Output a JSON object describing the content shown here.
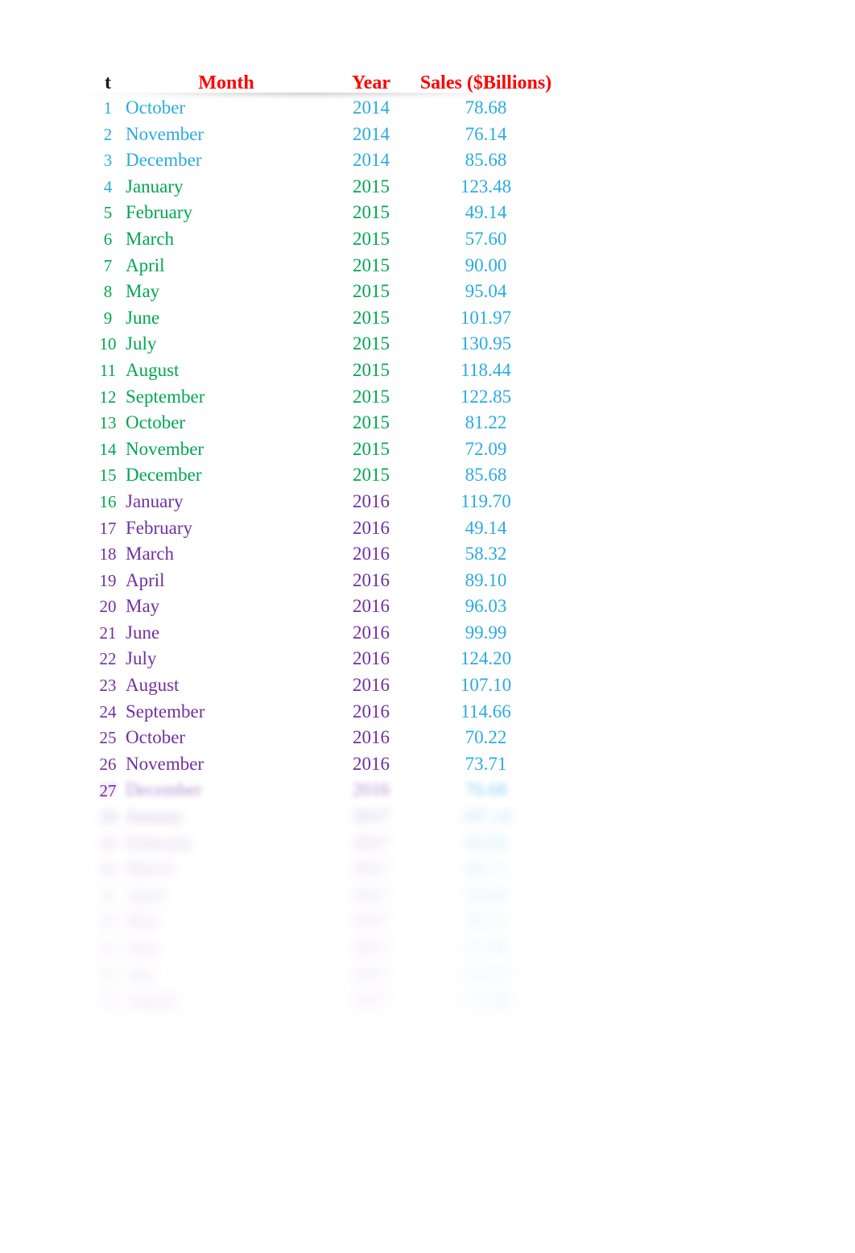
{
  "header": {
    "t_label": "t",
    "month_label": "Month",
    "year_label": "Year",
    "sales_label": "Sales ($Billions)"
  },
  "colors": {
    "header_accent": "#FF0000",
    "header_t": "#1A1A1A",
    "year_2014": "#29ABE2",
    "year_2015": "#00A651",
    "year_2016": "#7030A0",
    "sales": "#29ABE2"
  },
  "table_data": {
    "type": "table",
    "columns": [
      "t",
      "Month",
      "Year",
      "Sales ($Billions)"
    ],
    "rows": [
      {
        "t": "1",
        "month": "October",
        "year": "2014",
        "sales": "78.68",
        "t_color": "#29ABE2",
        "row_color": "#29ABE2",
        "blur": 0,
        "opacity": 1
      },
      {
        "t": "2",
        "month": "November",
        "year": "2014",
        "sales": "76.14",
        "t_color": "#29ABE2",
        "row_color": "#29ABE2",
        "blur": 0,
        "opacity": 1
      },
      {
        "t": "3",
        "month": "December",
        "year": "2014",
        "sales": "85.68",
        "t_color": "#29ABE2",
        "row_color": "#29ABE2",
        "blur": 0,
        "opacity": 1
      },
      {
        "t": "4",
        "month": "January",
        "year": "2015",
        "sales": "123.48",
        "t_color": "#29ABE2",
        "row_color": "#00A651",
        "blur": 0,
        "opacity": 1
      },
      {
        "t": "5",
        "month": "February",
        "year": "2015",
        "sales": "49.14",
        "t_color": "#00A651",
        "row_color": "#00A651",
        "blur": 0,
        "opacity": 1
      },
      {
        "t": "6",
        "month": "March",
        "year": "2015",
        "sales": "57.60",
        "t_color": "#00A651",
        "row_color": "#00A651",
        "blur": 0,
        "opacity": 1
      },
      {
        "t": "7",
        "month": "April",
        "year": "2015",
        "sales": "90.00",
        "t_color": "#00A651",
        "row_color": "#00A651",
        "blur": 0,
        "opacity": 1
      },
      {
        "t": "8",
        "month": "May",
        "year": "2015",
        "sales": "95.04",
        "t_color": "#00A651",
        "row_color": "#00A651",
        "blur": 0,
        "opacity": 1
      },
      {
        "t": "9",
        "month": "June",
        "year": "2015",
        "sales": "101.97",
        "t_color": "#00A651",
        "row_color": "#00A651",
        "blur": 0,
        "opacity": 1
      },
      {
        "t": "10",
        "month": "July",
        "year": "2015",
        "sales": "130.95",
        "t_color": "#00A651",
        "row_color": "#00A651",
        "blur": 0,
        "opacity": 1
      },
      {
        "t": "11",
        "month": "August",
        "year": "2015",
        "sales": "118.44",
        "t_color": "#00A651",
        "row_color": "#00A651",
        "blur": 0,
        "opacity": 1
      },
      {
        "t": "12",
        "month": "September",
        "year": "2015",
        "sales": "122.85",
        "t_color": "#00A651",
        "row_color": "#00A651",
        "blur": 0,
        "opacity": 1
      },
      {
        "t": "13",
        "month": "October",
        "year": "2015",
        "sales": "81.22",
        "t_color": "#00A651",
        "row_color": "#00A651",
        "blur": 0,
        "opacity": 1
      },
      {
        "t": "14",
        "month": "November",
        "year": "2015",
        "sales": "72.09",
        "t_color": "#00A651",
        "row_color": "#00A651",
        "blur": 0,
        "opacity": 1
      },
      {
        "t": "15",
        "month": "December",
        "year": "2015",
        "sales": "85.68",
        "t_color": "#00A651",
        "row_color": "#00A651",
        "blur": 0,
        "opacity": 1
      },
      {
        "t": "16",
        "month": "January",
        "year": "2016",
        "sales": "119.70",
        "t_color": "#00A651",
        "row_color": "#7030A0",
        "blur": 0,
        "opacity": 1
      },
      {
        "t": "17",
        "month": "February",
        "year": "2016",
        "sales": "49.14",
        "t_color": "#7030A0",
        "row_color": "#7030A0",
        "blur": 0,
        "opacity": 1
      },
      {
        "t": "18",
        "month": "March",
        "year": "2016",
        "sales": "58.32",
        "t_color": "#7030A0",
        "row_color": "#7030A0",
        "blur": 0,
        "opacity": 1
      },
      {
        "t": "19",
        "month": "April",
        "year": "2016",
        "sales": "89.10",
        "t_color": "#7030A0",
        "row_color": "#7030A0",
        "blur": 0,
        "opacity": 1
      },
      {
        "t": "20",
        "month": "May",
        "year": "2016",
        "sales": "96.03",
        "t_color": "#7030A0",
        "row_color": "#7030A0",
        "blur": 0,
        "opacity": 1
      },
      {
        "t": "21",
        "month": "June",
        "year": "2016",
        "sales": "99.99",
        "t_color": "#7030A0",
        "row_color": "#7030A0",
        "blur": 0,
        "opacity": 1
      },
      {
        "t": "22",
        "month": "July",
        "year": "2016",
        "sales": "124.20",
        "t_color": "#7030A0",
        "row_color": "#7030A0",
        "blur": 0,
        "opacity": 1
      },
      {
        "t": "23",
        "month": "August",
        "year": "2016",
        "sales": "107.10",
        "t_color": "#7030A0",
        "row_color": "#7030A0",
        "blur": 0,
        "opacity": 1
      },
      {
        "t": "24",
        "month": "September",
        "year": "2016",
        "sales": "114.66",
        "t_color": "#7030A0",
        "row_color": "#7030A0",
        "blur": 0,
        "opacity": 1
      },
      {
        "t": "25",
        "month": "October",
        "year": "2016",
        "sales": "70.22",
        "t_color": "#7030A0",
        "row_color": "#7030A0",
        "blur": 0,
        "opacity": 1
      },
      {
        "t": "26",
        "month": "November",
        "year": "2016",
        "sales": "73.71",
        "t_color": "#7030A0",
        "row_color": "#7030A0",
        "blur": 0,
        "opacity": 1
      },
      {
        "t": "27",
        "month": "December",
        "year": "2016",
        "sales": "70.68",
        "t_color": "#7030A0",
        "row_color": "#7030A0",
        "blur": 3.5,
        "opacity": 0.55
      },
      {
        "t": "28",
        "month": "January",
        "year": "2017",
        "sales": "107.14",
        "t_color": "#7030A0",
        "row_color": "#7030A0",
        "blur": 5.5,
        "opacity": 0.36
      },
      {
        "t": "29",
        "month": "February",
        "year": "2017",
        "sales": "60.99",
        "t_color": "#7030A0",
        "row_color": "#7030A0",
        "blur": 6.5,
        "opacity": 0.3
      },
      {
        "t": "30",
        "month": "March",
        "year": "2017",
        "sales": "66.71",
        "t_color": "#7030A0",
        "row_color": "#7030A0",
        "blur": 7.0,
        "opacity": 0.27
      },
      {
        "t": "31",
        "month": "April",
        "year": "2017",
        "sales": "94.48",
        "t_color": "#7030A0",
        "row_color": "#7030A0",
        "blur": 7.5,
        "opacity": 0.25
      },
      {
        "t": "32",
        "month": "May",
        "year": "2017",
        "sales": "99.11",
        "t_color": "#7030A0",
        "row_color": "#7030A0",
        "blur": 7.8,
        "opacity": 0.24
      },
      {
        "t": "33",
        "month": "June",
        "year": "2017",
        "sales": "97.66",
        "t_color": "#7030A0",
        "row_color": "#7030A0",
        "blur": 8.0,
        "opacity": 0.23
      },
      {
        "t": "34",
        "month": "July",
        "year": "2017",
        "sales": "123.03",
        "t_color": "#7030A0",
        "row_color": "#7030A0",
        "blur": 8.2,
        "opacity": 0.22
      },
      {
        "t": "35",
        "month": "August",
        "year": "2017",
        "sales": "111.88",
        "t_color": "#7030A0",
        "row_color": "#7030A0",
        "blur": 8.4,
        "opacity": 0.22
      }
    ]
  }
}
